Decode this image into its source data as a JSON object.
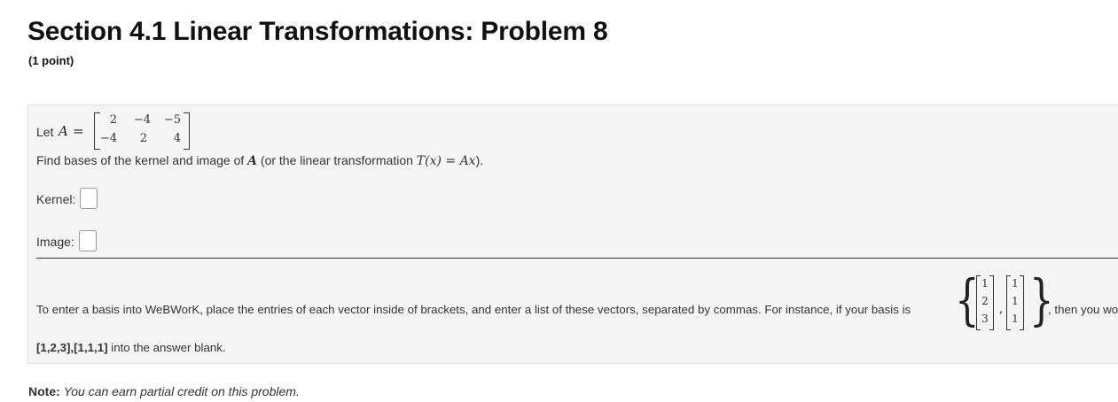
{
  "header": {
    "title": "Section 4.1 Linear Transformations: Problem 8",
    "points": "(1 point)"
  },
  "problem": {
    "let_prefix": "Let",
    "matrix_symbol": "A",
    "equals": "=",
    "matrix": [
      [
        "2",
        "−4",
        "−5"
      ],
      [
        "−4",
        "2",
        "4"
      ]
    ],
    "instruction_prefix": "Find bases of the kernel and image of",
    "instruction_symbol": "A",
    "instruction_middle": "(or the linear transformation",
    "instruction_formula": "T(x) = Ax",
    "instruction_suffix": ").",
    "kernel_label": "Kernel:",
    "kernel_value": "",
    "image_label": "Image:",
    "image_value": ""
  },
  "hint": {
    "text_before": "To enter a basis into WeBWorK, place the entries of each vector inside of brackets, and enter a list of these vectors, separated by commas. For instance, if your basis is",
    "text_after": ", then you wo",
    "example_vectors": [
      [
        "1",
        "2",
        "3"
      ],
      [
        "1",
        "1",
        "1"
      ]
    ],
    "set_open": "{",
    "set_close": "}",
    "comma": ",",
    "example_answer": "[1,2,3],[1,1,1]",
    "answer_suffix": "into the answer blank."
  },
  "footer": {
    "note_label": "Note:",
    "note_text": "You can earn partial credit on this problem."
  }
}
